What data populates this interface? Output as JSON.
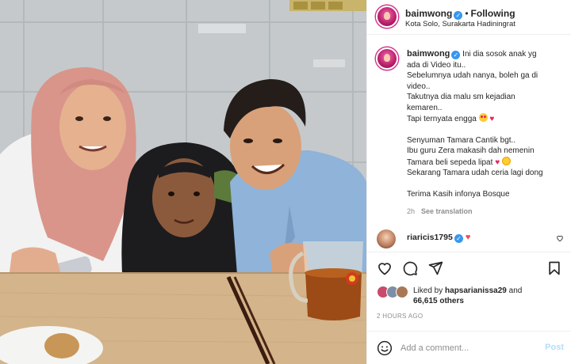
{
  "post": {
    "username": "baimwong",
    "follow_status": "Following",
    "location": "Kota Solo, Surakarta Hadiningrat"
  },
  "caption": {
    "username": "baimwong",
    "lines": [
      "Ini dia sosok anak yg",
      "ada di Video itu..",
      "Sebelumnya udah nanya, boleh ga di",
      "video..",
      "Takutnya dia malu sm kejadian",
      "kemaren..",
      "Tapi ternyata engga",
      "Senyuman Tamara Cantik bgt..",
      "Ibu guru Zera makasih dah nemenin",
      "Tamara beli sepeda lipat",
      "Sekarang Tamara udah ceria lagi dong",
      "Terima Kasih infonya Bosque"
    ],
    "age": "2h",
    "see_translation": "See translation"
  },
  "comment": {
    "username": "riaricis1795"
  },
  "likes": {
    "liked_by_prefix": "Liked by",
    "liked_by_user": "hapsarianissa29",
    "and_text": "and",
    "count": "66,615 others"
  },
  "timestamp": "2 HOURS AGO",
  "add_comment": {
    "placeholder": "Add a comment...",
    "post_label": "Post"
  },
  "icons": [
    "heart-icon",
    "comment-icon",
    "share-icon",
    "bookmark-icon",
    "emoji-icon",
    "verified-icon"
  ],
  "colors": {
    "verified": "#3897f0",
    "heart": "#ed4956",
    "post_disabled": "#b2dffc",
    "meta": "#8e8e8e"
  }
}
